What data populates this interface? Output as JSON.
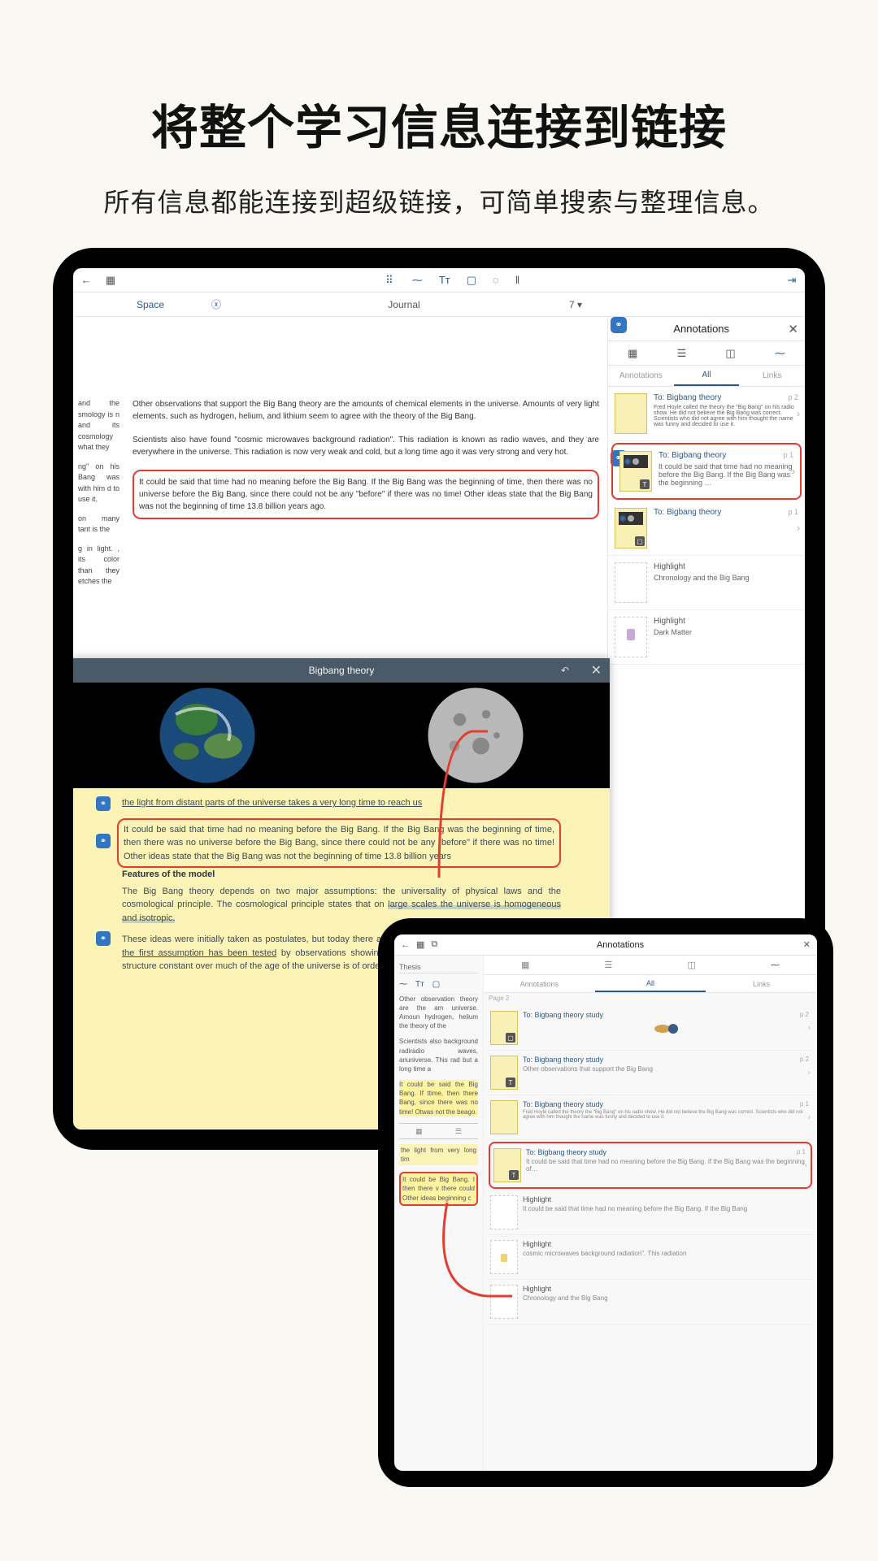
{
  "marketing": {
    "title": "将整个学习信息连接到链接",
    "sub": "所有信息都能连接到超级链接，可简单搜索与整理信息。"
  },
  "tablet": {
    "subhead": {
      "space": "Space",
      "journal": "Journal",
      "page": "7 ▾"
    },
    "doc_left": {
      "p1": "and the smology is n and its cosmology what they",
      "p2": "ng\" on his Bang was with him d to use it.",
      "p3": "on many tant is the",
      "p4": "g in light. , its color than they etches the"
    },
    "doc_mid": {
      "p1": "Other observations that support the Big Bang theory are the amounts of chemical elements in the universe. Amounts of very light elements, such as hydrogen, helium, and lithium seem to agree with the theory of the Big Bang.",
      "p2": "Scientists also have found \"cosmic microwaves background radiation\". This radiation is known as radio waves, and they are everywhere in the universe. This radiation is now very weak and cold, but a long time ago it was very strong and very hot.",
      "p3": "It could be said that time had no meaning before the Big Bang. If the Big Bang was the beginning of time, then there was no universe before the Big Bang, since there could not be any \"before\" if there was no time! Other ideas state that the Big Bang was not the beginning of time 13.8 billion years ago."
    },
    "annotations": {
      "panel_title": "Annotations",
      "tab_annotations": "Annotations",
      "tab_all": "All",
      "tab_links": "Links",
      "items": [
        {
          "title": "To: Bigbang theory",
          "page": "p 2",
          "desc": "Fred Hoyle called the theory the \"Big Bang\" on his radio show. He did not believe the Big Bang was correct. Scientists who did not agree with him thought the name was funny and decided to use it."
        },
        {
          "title": "To: Bigbang theory",
          "page": "p 1",
          "desc": "It could be said that time had no meaning before the Big Bang. If the Big Bang was the beginning …"
        },
        {
          "title": "To: Bigbang theory",
          "page": "p 1",
          "desc": ""
        },
        {
          "title": "Highlight",
          "page": "",
          "desc": "Chronology and the Big Bang"
        },
        {
          "title": "Highlight",
          "page": "",
          "desc": "Dark Matter"
        }
      ]
    }
  },
  "overlay": {
    "title": "Bigbang theory",
    "note": {
      "p1": "the light from distant parts of the universe takes a very long time to reach us",
      "p2": "It could be said that time had no meaning before the Big Bang. If the Big Bang was the beginning of time, then there was no universe before the Big Bang, since there could not be any \"before\" if there was no time! Other ideas state that the Big Bang was not the beginning of time 13.8 billion years",
      "h": "Features of the model",
      "p3a": "The Big Bang theory depends on two major assumptions: the universality of physical laws and the cosmological principle. The cosmological principle states that on ",
      "p3b": "large scales the universe is homogeneous and isotropic.",
      "p4a": "These ideas were initially taken as postulates, but today there are efforts to test each of them. For ",
      "p4b": "example, the first assumption has been tested",
      "p4c": " by observations showing that largest possible deviation of the fine structure constant over much of the age of the universe is of order 10−5."
    }
  },
  "phone": {
    "head_title": "Annotations",
    "left_sub": "Thesis",
    "tab_annotations": "Annotations",
    "tab_all": "All",
    "tab_links": "Links",
    "page_label": "Page 2",
    "doc": {
      "p1": "Other observation theory are the am universe. Amoun hydrogen, helium the theory of the",
      "p2": "Scientists also background radiradio waves, anuniverse. This rad but a long time a",
      "p3": "It could be said the Big Bang. If ttime, then there Bang, since there was no time! Otwas not the beago.",
      "p4": "the light from very long tim",
      "p5": "It could be Big Bang. I then there v there could Other ideas beginning c"
    },
    "items": [
      {
        "title": "To: Bigbang theory study",
        "page": "p 2",
        "desc": ""
      },
      {
        "title": "To: Bigbang theory study",
        "page": "p 2",
        "desc": "Other observations that support the Big Bang"
      },
      {
        "title": "To: Bigbang theory study",
        "page": "p 1",
        "desc": "Fred Hoyle called the theory the \"Big Bang\" on his radio show. He did not believe the Big Bang was correct. Scientists who did not agree with him thought the name was funny and decided to use it."
      },
      {
        "title": "To: Bigbang theory study",
        "page": "p 1",
        "desc": "It could be said that time had no meaning before the Big Bang. If the Big Bang was the beginning of…"
      },
      {
        "title": "Highlight",
        "page": "",
        "desc": "It could be said that time had no meaning before the Big Bang. If the Big Bang"
      },
      {
        "title": "Highlight",
        "page": "",
        "desc": "cosmic microwaves background radiation\". This radiation"
      },
      {
        "title": "Highlight",
        "page": "",
        "desc": "Chronology and the Big Bang"
      }
    ]
  }
}
